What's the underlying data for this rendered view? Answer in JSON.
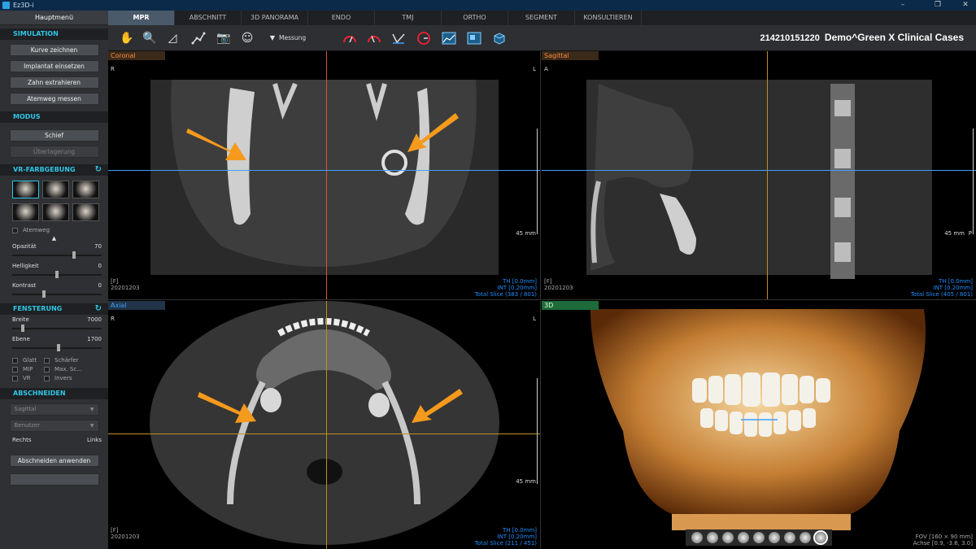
{
  "window": {
    "title": "Ez3D-i",
    "minimize": "–",
    "maximize": "❐",
    "close": "✕"
  },
  "sidebar": {
    "main_menu": "Hauptmenü",
    "simulation": {
      "title": "SIMULATION",
      "buttons": [
        "Kurve zeichnen",
        "Implantat einsetzen",
        "Zahn extrahieren",
        "Atemweg messen"
      ]
    },
    "modus": {
      "title": "MODUS",
      "buttons": [
        "Schief",
        "Überlagerung"
      ]
    },
    "vr": {
      "title": "VR-FARBGEBUNG",
      "airway": "Atemweg",
      "sliders": [
        {
          "label": "Opazität",
          "value": "70",
          "pos": 0.7
        },
        {
          "label": "Helligkeit",
          "value": "0",
          "pos": 0.5
        },
        {
          "label": "Kontrast",
          "value": "0",
          "pos": 0.35
        }
      ]
    },
    "fensterung": {
      "title": "FENSTERUNG",
      "sliders": [
        {
          "label": "Breite",
          "value": "7000",
          "pos": 0.1
        },
        {
          "label": "Ebene",
          "value": "1700",
          "pos": 0.52
        }
      ],
      "checks": [
        "Glatt",
        "Schärfer",
        "MIP",
        "Max. Sc...",
        "VR",
        "Invers"
      ]
    },
    "abschneiden": {
      "title": "ABSCHNEIDEN",
      "dropdown1": "Sagittal",
      "dropdown2": "Benutzer",
      "right": "Rechts",
      "left": "Links",
      "apply": "Abschneiden anwenden"
    }
  },
  "tabs": [
    "MPR",
    "ABSCHNITT",
    "3D PANORAMA",
    "ENDO",
    "TMJ",
    "ORTHO",
    "SEGMENT",
    "KONSULTIEREN"
  ],
  "toolbar": {
    "messung": "Messung"
  },
  "patient": {
    "id": "214210151220",
    "name": "Demo^Green X Clinical Cases"
  },
  "views": {
    "coronal": {
      "title": "Coronal",
      "left": "R",
      "right": "L",
      "fl": "[F]",
      "date": "20201203",
      "mm": "45 mm",
      "th": "TH [0.0mm]",
      "int": "INT [0.20mm]",
      "slice": "Total Slice (383 / 801)"
    },
    "sagittal": {
      "title": "Sagittal",
      "left": "A",
      "right": "P",
      "fl": "[F]",
      "date": "20201203",
      "mm": "45 mm",
      "th": "TH [0.0mm]",
      "int": "INT [0.20mm]",
      "slice": "Total Slice (405 / 801)"
    },
    "axial": {
      "title": "Axial",
      "left": "R",
      "right": "L",
      "fl": "[F]",
      "date": "20201203",
      "mm": "45 mm",
      "th": "TH [0.0mm]",
      "int": "INT [0.20mm]",
      "slice": "Total Slice (211 / 451)"
    },
    "vr3d": {
      "title": "3D",
      "fov": "FOV [160 × 90 mm]",
      "axis": "Achse [0.9, -3.6, 3.0]"
    }
  },
  "colors": {
    "accent": "#2fc6e6",
    "coronal_line": "#d05a2a",
    "axial_line": "#3ea0ff",
    "sagittal_line": "#c09020",
    "arrow": "#f59a1c"
  }
}
